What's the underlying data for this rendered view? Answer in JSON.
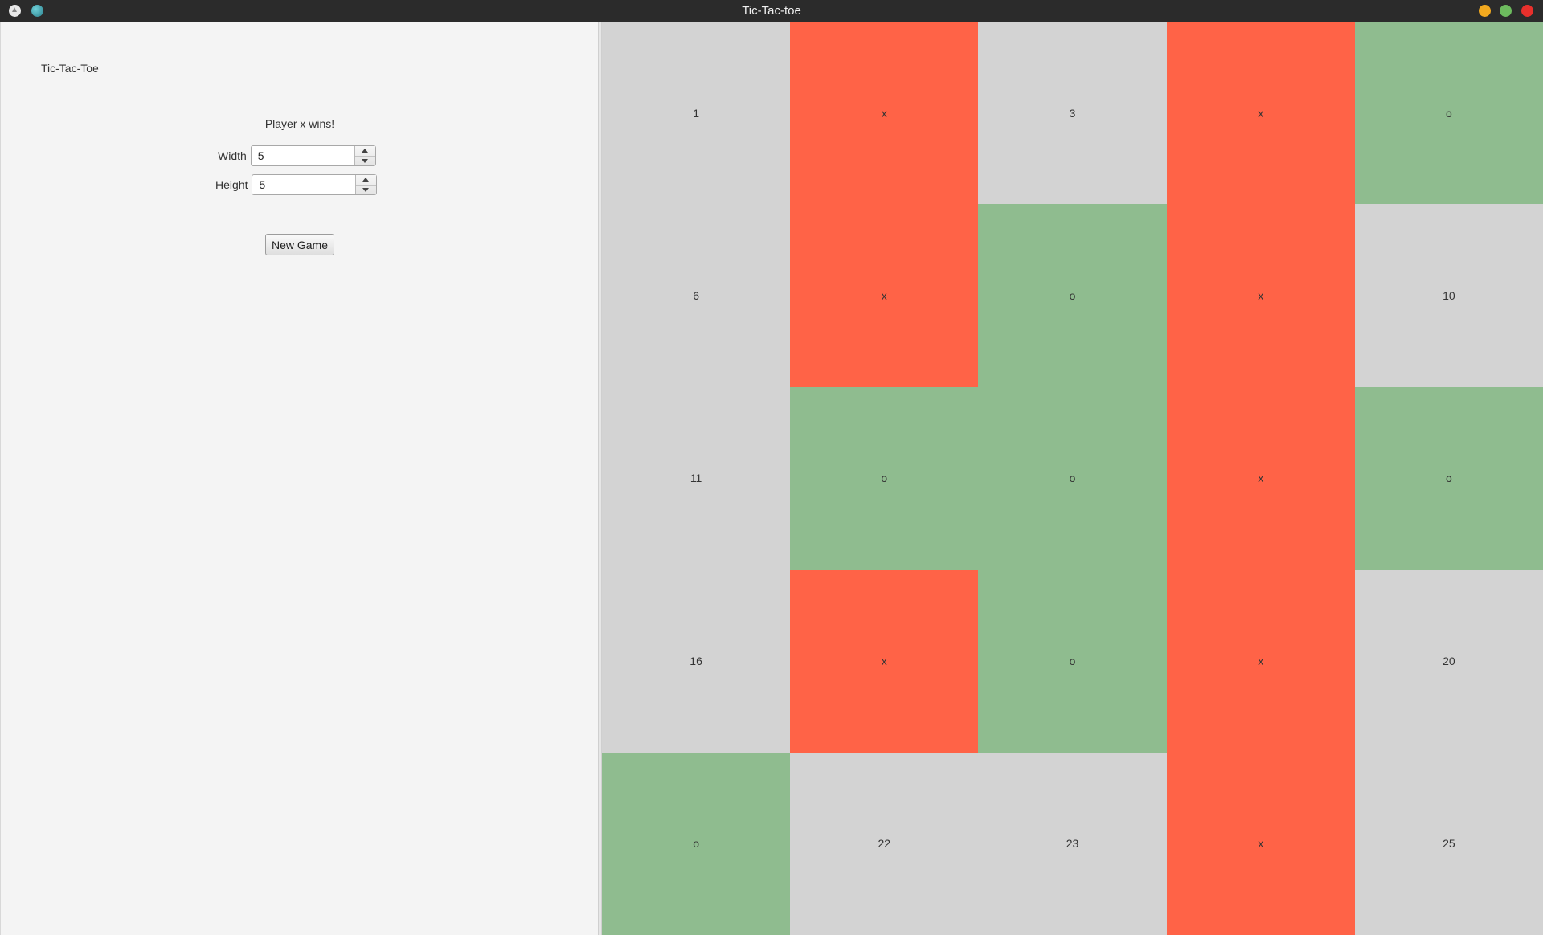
{
  "window": {
    "title": "Tic-Tac-toe"
  },
  "titlebar_icons": [
    "app-menu-icon",
    "sphere-icon",
    "minimize-icon",
    "maximize-icon",
    "close-icon"
  ],
  "panel": {
    "app_title": "Tic-Tac-Toe",
    "status": "Player x wins!",
    "width_label": "Width",
    "width_value": "5",
    "height_label": "Height",
    "height_value": "5",
    "new_game_label": "New Game"
  },
  "colors": {
    "x": "#ff6347",
    "o": "#8fbc8f",
    "empty": "#d3d3d3"
  },
  "board": {
    "cols": 5,
    "rows": 5,
    "cells": [
      "1",
      "x",
      "3",
      "x",
      "o",
      "6",
      "x",
      "o",
      "x",
      "10",
      "11",
      "o",
      "o",
      "x",
      "o",
      "16",
      "x",
      "o",
      "x",
      "20",
      "o",
      "22",
      "23",
      "x",
      "25"
    ]
  }
}
